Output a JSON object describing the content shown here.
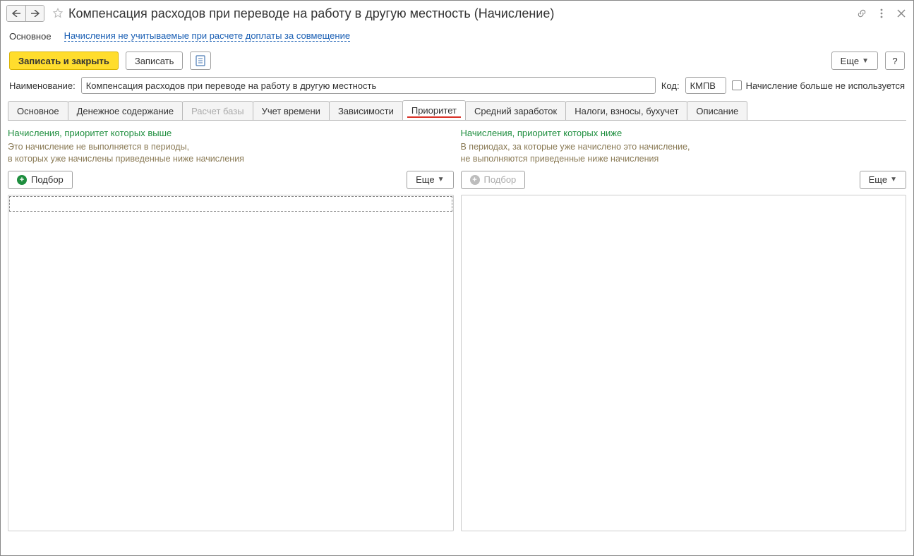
{
  "window": {
    "title": "Компенсация расходов при переводе на работу в другую местность (Начисление)"
  },
  "sections": {
    "current": "Основное",
    "link": "Начисления не учитываемые при расчете доплаты за совмещение"
  },
  "commands": {
    "saveClose": "Записать и закрыть",
    "save": "Записать",
    "more": "Еще",
    "help": "?"
  },
  "form": {
    "nameLabel": "Наименование:",
    "nameValue": "Компенсация расходов при переводе на работу в другую местность",
    "codeLabel": "Код:",
    "codeValue": "КМПВ",
    "noLongerUsed": "Начисление больше не используется"
  },
  "tabs": {
    "main": "Основное",
    "pay": "Денежное содержание",
    "base": "Расчет базы",
    "time": "Учет времени",
    "deps": "Зависимости",
    "priority": "Приоритет",
    "avg": "Средний заработок",
    "tax": "Налоги, взносы, бухучет",
    "desc": "Описание"
  },
  "priority": {
    "higher": {
      "title": "Начисления, приоритет которых выше",
      "descLine1": "Это начисление не выполняется в периоды,",
      "descLine2": "в которых уже начислены приведенные ниже начисления",
      "pick": "Подбор",
      "more": "Еще"
    },
    "lower": {
      "title": "Начисления, приоритет которых ниже",
      "descLine1": "В периодах, за которые уже начислено это начисление,",
      "descLine2": "не выполняются приведенные ниже начисления",
      "pick": "Подбор",
      "more": "Еще"
    }
  }
}
